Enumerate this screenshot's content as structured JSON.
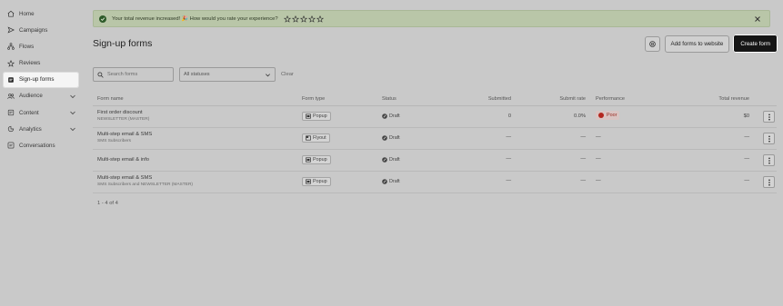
{
  "sidebar": {
    "items": [
      {
        "label": "Home",
        "icon": "home-icon"
      },
      {
        "label": "Campaigns",
        "icon": "send-icon"
      },
      {
        "label": "Flows",
        "icon": "flows-icon"
      },
      {
        "label": "Reviews",
        "icon": "star-icon"
      },
      {
        "label": "Sign-up forms",
        "icon": "form-icon",
        "active": true
      },
      {
        "label": "Audience",
        "icon": "audience-icon",
        "expandable": true
      },
      {
        "label": "Content",
        "icon": "content-icon",
        "expandable": true
      },
      {
        "label": "Analytics",
        "icon": "analytics-icon",
        "expandable": true
      },
      {
        "label": "Conversations",
        "icon": "chat-icon"
      }
    ]
  },
  "banner": {
    "text": "Your total revenue increased! 🎉 How would you rate your experience?",
    "stars": 5,
    "color": "#b9c6a8"
  },
  "page": {
    "title": "Sign-up forms",
    "add_to_website_label": "Add forms to website",
    "create_form_label": "Create form"
  },
  "filters": {
    "search_placeholder": "Search forms",
    "status_value": "All statuses",
    "clear_label": "Clear"
  },
  "table": {
    "columns": [
      "Form name",
      "Form type",
      "Status",
      "Submitted",
      "Submit rate",
      "Performance",
      "Total revenue"
    ],
    "rows": [
      {
        "name": "First order discount",
        "sub": "NEWSLETTER (MASTER)",
        "type": "Popup",
        "type_icon": "popup-icon",
        "status": "Draft",
        "submitted": "0",
        "rate": "0.0%",
        "performance": "Poor",
        "revenue": "$0"
      },
      {
        "name": "Multi-step email & SMS",
        "sub": "SMS Subscribers",
        "type": "Flyout",
        "type_icon": "flyout-icon",
        "status": "Draft",
        "submitted": "—",
        "rate": "—",
        "performance": "—",
        "revenue": "—"
      },
      {
        "name": "Multi-step email & info",
        "sub": "",
        "type": "Popup",
        "type_icon": "popup-icon",
        "status": "Draft",
        "submitted": "—",
        "rate": "—",
        "performance": "—",
        "revenue": "—"
      },
      {
        "name": "Multi-step email & SMS",
        "sub": "SMS Subscribers and NEWSLETTER (MASTER)",
        "type": "Popup",
        "type_icon": "popup-icon",
        "status": "Draft",
        "submitted": "—",
        "rate": "—",
        "performance": "—",
        "revenue": "—"
      }
    ],
    "count_label": "1 - 4 of 4"
  },
  "colors": {
    "poor": "#b3261e",
    "primary_button": "#151515"
  }
}
